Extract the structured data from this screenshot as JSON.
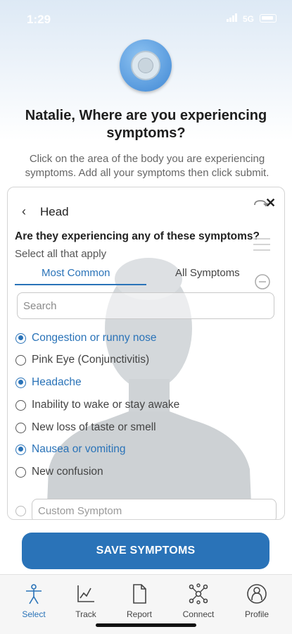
{
  "status_bar": {
    "time": "1:29",
    "network": "5G"
  },
  "header": {
    "title": "Natalie, Where are you experiencing symptoms?",
    "subtitle": "Click on the area of the body you are experiencing symptoms. Add all your symptoms then click submit."
  },
  "panel": {
    "region": "Head",
    "back_icon": "chevron-left-icon",
    "close_icon": "close-icon",
    "question": "Are they experiencing any of these symptoms?",
    "instruction": "Select all that apply",
    "tabs": [
      {
        "label": "Most Common",
        "active": true
      },
      {
        "label": "All Symptoms",
        "active": false
      }
    ],
    "search_placeholder": "Search",
    "symptoms": [
      {
        "label": "Congestion or runny nose",
        "selected": true
      },
      {
        "label": "Pink Eye (Conjunctivitis)",
        "selected": false
      },
      {
        "label": "Headache",
        "selected": true
      },
      {
        "label": "Inability to wake or stay awake",
        "selected": false
      },
      {
        "label": "New loss of taste or smell",
        "selected": false
      },
      {
        "label": "Nausea or vomiting",
        "selected": true
      },
      {
        "label": "New confusion",
        "selected": false
      }
    ],
    "custom_placeholder": "Custom Symptom"
  },
  "save_button": "SAVE SYMPTOMS",
  "nav": [
    {
      "label": "Select",
      "icon": "body-icon",
      "active": true
    },
    {
      "label": "Track",
      "icon": "chart-icon",
      "active": false
    },
    {
      "label": "Report",
      "icon": "document-icon",
      "active": false
    },
    {
      "label": "Connect",
      "icon": "network-icon",
      "active": false
    },
    {
      "label": "Profile",
      "icon": "profile-icon",
      "active": false
    }
  ],
  "colors": {
    "accent": "#2a73b8",
    "text": "#222222",
    "muted": "#666666"
  }
}
